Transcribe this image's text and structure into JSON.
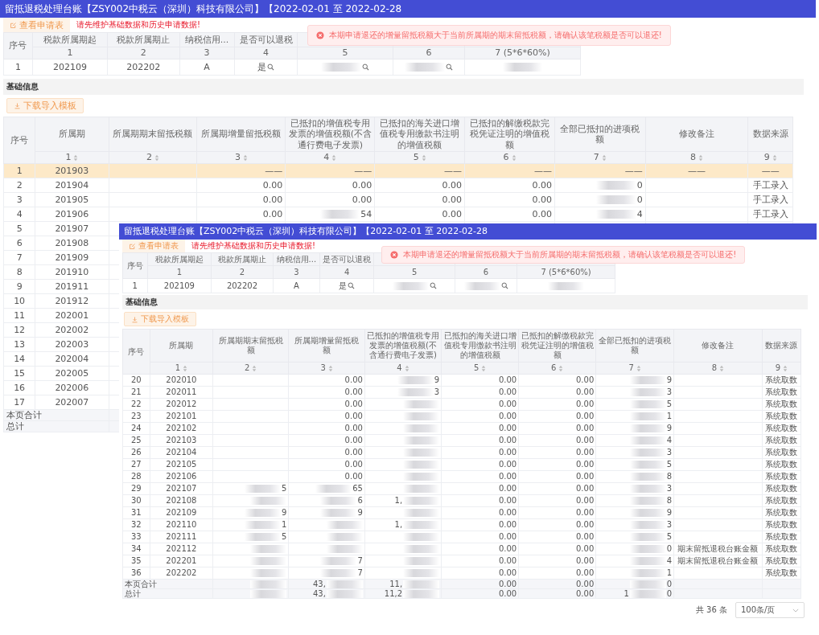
{
  "windows": [
    {
      "title": "留抵退税处理台账【ZSY002中税云（深圳）科技有限公司】【2022-02-01 至 2022-02-28",
      "view_button": "查看申请表",
      "warning": "请先维护基础数据和历史申请数据!",
      "toast": "本期申请退还的增量留抵税额大于当前所属期的期末留抵税额，请确认该笔税额是否可以退还!",
      "summary": {
        "columns": [
          "序号",
          "税款所属期起",
          "税款所属期止",
          "纳税信用...",
          "是否可以退税"
        ],
        "numbers": [
          "1",
          "2",
          "3",
          "4",
          "5",
          "6",
          "7 (5*6*60%)"
        ],
        "row": [
          "1",
          "202109",
          "202202",
          "A",
          {
            "kind": "search",
            "text": "是"
          },
          {
            "kind": "redacted_search"
          },
          {
            "kind": "redacted_search"
          },
          {
            "kind": "redacted"
          }
        ]
      },
      "section": "基础信息",
      "download_button": "下载导入模板",
      "table": {
        "columns": [
          "序号",
          "所属期",
          "所属期期末留抵税额",
          "所属期增量留抵税额",
          "已抵扣的增值税专用发票的增值税额(不含通行费电子发票)",
          "已抵扣的海关进口增值税专用缴款书注明的增值税额",
          "已抵扣的解缴税款完税凭证注明的增值税额",
          "全部已抵扣的进项税额",
          "修改备注",
          "数据来源"
        ],
        "numbers": [
          "1",
          "2",
          "3",
          "4",
          "5",
          "6",
          "7",
          "8",
          "9"
        ],
        "rows": [
          {
            "selected": true,
            "cells": [
              "1",
              "201903",
              null,
              "——",
              "——",
              "——",
              "——",
              "——",
              "——",
              "——"
            ]
          },
          {
            "selected": false,
            "cells": [
              "2",
              "201904",
              null,
              "0.00",
              "0.00",
              "0.00",
              "0.00",
              {
                "kind": "redacted",
                "post": "0"
              },
              null,
              "手工录入"
            ]
          },
          {
            "selected": false,
            "cells": [
              "3",
              "201905",
              null,
              "0.00",
              "0.00",
              "0.00",
              "0.00",
              {
                "kind": "redacted",
                "post": "0"
              },
              null,
              "手工录入"
            ]
          },
          {
            "selected": false,
            "cells": [
              "4",
              "201906",
              null,
              "0.00",
              {
                "kind": "redacted",
                "post": "54"
              },
              "0.00",
              "0.00",
              {
                "kind": "redacted",
                "post": "4"
              },
              null,
              "手工录入"
            ]
          },
          {
            "selected": false,
            "cells": [
              "5",
              "201907"
            ]
          },
          {
            "selected": false,
            "cells": [
              "6",
              "201908"
            ]
          },
          {
            "selected": false,
            "cells": [
              "7",
              "201909"
            ]
          },
          {
            "selected": false,
            "cells": [
              "8",
              "201910"
            ]
          },
          {
            "selected": false,
            "cells": [
              "9",
              "201911"
            ]
          },
          {
            "selected": false,
            "cells": [
              "10",
              "201912"
            ]
          },
          {
            "selected": false,
            "cells": [
              "11",
              "202001"
            ]
          },
          {
            "selected": false,
            "cells": [
              "12",
              "202002"
            ]
          },
          {
            "selected": false,
            "cells": [
              "13",
              "202003"
            ]
          },
          {
            "selected": false,
            "cells": [
              "14",
              "202004"
            ]
          },
          {
            "selected": false,
            "cells": [
              "15",
              "202005"
            ]
          },
          {
            "selected": false,
            "cells": [
              "16",
              "202006"
            ]
          },
          {
            "selected": false,
            "cells": [
              "17",
              "202007"
            ]
          }
        ],
        "totals": [
          {
            "label": "本页合计"
          },
          {
            "label": "总计"
          }
        ]
      }
    },
    {
      "title": "留抵退税处理台账【ZSY002中税云（深圳）科技有限公司】【2022-02-01 至 2022-02-28",
      "view_button": "查看申请表",
      "warning": "请先维护基础数据和历史申请数据!",
      "toast": "本期申请退还的增量留抵税额大于当前所属期的期末留抵税额，请确认该笔税额是否可以退还!",
      "summary": {
        "columns": [
          "序号",
          "税款所属期起",
          "税款所属期止",
          "纳税信用...",
          "是否可以退税"
        ],
        "numbers": [
          "1",
          "2",
          "3",
          "4",
          "5",
          "6",
          "7 (5*6*60%)"
        ],
        "row": [
          "1",
          "202109",
          "202202",
          "A",
          {
            "kind": "search",
            "text": "是"
          },
          {
            "kind": "redacted_search"
          },
          {
            "kind": "redacted_search"
          },
          {
            "kind": "redacted"
          }
        ]
      },
      "section": "基础信息",
      "download_button": "下载导入模板",
      "table": {
        "columns": [
          "序号",
          "所属期",
          "所属期期末留抵税额",
          "所属期增量留抵税额",
          "已抵扣的增值税专用发票的增值税额(不含通行费电子发票)",
          "已抵扣的海关进口增值税专用缴款书注明的增值税额",
          "已抵扣的解缴税款完税凭证注明的增值税额",
          "全部已抵扣的进项税额",
          "修改备注",
          "数据来源"
        ],
        "numbers": [
          "1",
          "2",
          "3",
          "4",
          "5",
          "6",
          "7",
          "8",
          "9"
        ],
        "rows": [
          {
            "selected": false,
            "cells": [
              "20",
              "202010",
              null,
              "0.00",
              {
                "kind": "redacted",
                "post": "9"
              },
              "0.00",
              "0.00",
              {
                "kind": "redacted",
                "post": "9"
              },
              null,
              "系统取数"
            ]
          },
          {
            "selected": false,
            "cells": [
              "21",
              "202011",
              null,
              "0.00",
              {
                "kind": "redacted",
                "post": "3"
              },
              "0.00",
              "0.00",
              {
                "kind": "redacted",
                "post": "3"
              },
              null,
              "系统取数"
            ]
          },
          {
            "selected": false,
            "cells": [
              "22",
              "202012",
              null,
              "0.00",
              {
                "kind": "redacted"
              },
              "0.00",
              "0.00",
              {
                "kind": "redacted",
                "post": "5"
              },
              null,
              "系统取数"
            ]
          },
          {
            "selected": false,
            "cells": [
              "23",
              "202101",
              null,
              "0.00",
              {
                "kind": "redacted"
              },
              "0.00",
              "0.00",
              {
                "kind": "redacted",
                "post": "1"
              },
              null,
              "系统取数"
            ]
          },
          {
            "selected": false,
            "cells": [
              "24",
              "202102",
              null,
              "0.00",
              {
                "kind": "redacted"
              },
              "0.00",
              "0.00",
              {
                "kind": "redacted",
                "post": "9"
              },
              null,
              "系统取数"
            ]
          },
          {
            "selected": false,
            "cells": [
              "25",
              "202103",
              null,
              "0.00",
              {
                "kind": "redacted"
              },
              "0.00",
              "0.00",
              {
                "kind": "redacted",
                "post": "4"
              },
              null,
              "系统取数"
            ]
          },
          {
            "selected": false,
            "cells": [
              "26",
              "202104",
              null,
              "0.00",
              {
                "kind": "redacted"
              },
              "0.00",
              "0.00",
              {
                "kind": "redacted",
                "post": "3"
              },
              null,
              "系统取数"
            ]
          },
          {
            "selected": false,
            "cells": [
              "27",
              "202105",
              null,
              "0.00",
              {
                "kind": "redacted"
              },
              "0.00",
              "0.00",
              {
                "kind": "redacted",
                "post": "5"
              },
              null,
              "系统取数"
            ]
          },
          {
            "selected": false,
            "cells": [
              "28",
              "202106",
              null,
              "0.00",
              {
                "kind": "redacted"
              },
              "0.00",
              "0.00",
              {
                "kind": "redacted",
                "post": "8"
              },
              null,
              "系统取数"
            ]
          },
          {
            "selected": false,
            "cells": [
              "29",
              "202107",
              {
                "kind": "redacted",
                "post": "5"
              },
              {
                "kind": "redacted",
                "post": "65"
              },
              {
                "kind": "redacted"
              },
              "0.00",
              "0.00",
              {
                "kind": "redacted",
                "post": "3"
              },
              null,
              "系统取数"
            ]
          },
          {
            "selected": false,
            "cells": [
              "30",
              "202108",
              {
                "kind": "redacted"
              },
              {
                "kind": "redacted",
                "post": "6"
              },
              {
                "kind": "redacted",
                "pre": "1,"
              },
              "0.00",
              "0.00",
              {
                "kind": "redacted",
                "post": "8"
              },
              null,
              "系统取数"
            ]
          },
          {
            "selected": false,
            "cells": [
              "31",
              "202109",
              {
                "kind": "redacted",
                "post": "9"
              },
              {
                "kind": "redacted",
                "post": "9"
              },
              {
                "kind": "redacted"
              },
              "0.00",
              "0.00",
              {
                "kind": "redacted",
                "post": "9"
              },
              null,
              "系统取数"
            ]
          },
          {
            "selected": false,
            "cells": [
              "32",
              "202110",
              {
                "kind": "redacted",
                "post": "1"
              },
              {
                "kind": "redacted"
              },
              {
                "kind": "redacted",
                "pre": "1,"
              },
              "0.00",
              "0.00",
              {
                "kind": "redacted",
                "post": "3"
              },
              null,
              "系统取数"
            ]
          },
          {
            "selected": false,
            "cells": [
              "33",
              "202111",
              {
                "kind": "redacted",
                "post": "5"
              },
              {
                "kind": "redacted"
              },
              {
                "kind": "redacted"
              },
              "0.00",
              "0.00",
              {
                "kind": "redacted",
                "post": "5"
              },
              null,
              "系统取数"
            ]
          },
          {
            "selected": false,
            "cells": [
              "34",
              "202112",
              {
                "kind": "redacted"
              },
              {
                "kind": "redacted"
              },
              {
                "kind": "redacted"
              },
              "0.00",
              "0.00",
              {
                "kind": "redacted",
                "post": "0"
              },
              "期末留抵退税台账金额",
              "系统取数"
            ]
          },
          {
            "selected": false,
            "cells": [
              "35",
              "202201",
              {
                "kind": "redacted"
              },
              {
                "kind": "redacted",
                "post": "7"
              },
              {
                "kind": "redacted"
              },
              "0.00",
              "0.00",
              {
                "kind": "redacted",
                "post": "4"
              },
              "期末留抵退税台账金额",
              "系统取数"
            ]
          },
          {
            "selected": false,
            "cells": [
              "36",
              "202202",
              {
                "kind": "redacted"
              },
              {
                "kind": "redacted",
                "post": "7"
              },
              {
                "kind": "redacted"
              },
              "0.00",
              "0.00",
              {
                "kind": "redacted",
                "post": "1"
              },
              null,
              "系统取数"
            ]
          }
        ],
        "totals": [
          {
            "label": "本页合计",
            "cells": [
              {
                "kind": "redacted"
              },
              {
                "kind": "redacted",
                "pre": "43,"
              },
              {
                "kind": "redacted",
                "pre": "11,"
              },
              "0.00",
              "0.00",
              {
                "kind": "redacted",
                "post": "0"
              },
              null,
              null
            ]
          },
          {
            "label": "总计",
            "cells": [
              {
                "kind": "redacted"
              },
              {
                "kind": "redacted",
                "pre": "43,"
              },
              {
                "kind": "redacted",
                "pre": "11,2"
              },
              "0.00",
              "0.00",
              {
                "kind": "redacted",
                "pre": "1",
                "post": "0"
              },
              null,
              null
            ]
          }
        ]
      },
      "pagination": {
        "total": "共 36 条",
        "page_size": "100条/页"
      }
    }
  ]
}
